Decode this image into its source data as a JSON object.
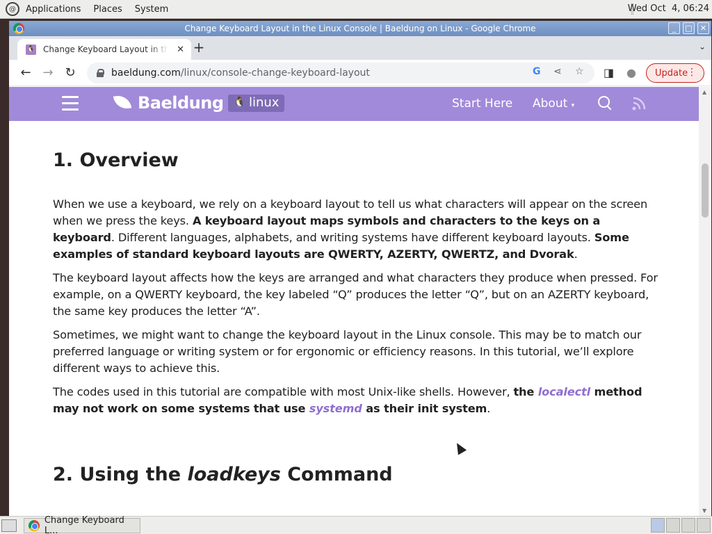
{
  "system_panel": {
    "menus": [
      "Applications",
      "Places",
      "System"
    ],
    "clock": "Wed Oct  4, 06:24"
  },
  "window": {
    "title": "Change Keyboard Layout in the Linux Console | Baeldung on Linux - Google Chrome",
    "buttons": [
      "_",
      "□",
      "✕"
    ]
  },
  "tabs": [
    {
      "title": "Change Keyboard Layout in the Linux Console | Baeldung on Linux",
      "close": "✕"
    }
  ],
  "new_tab": "+",
  "tab_list": "⌄",
  "toolbar": {
    "back": "←",
    "forward": "→",
    "reload": "↻",
    "url_host": "baeldung.com",
    "url_path": "/linux/console-change-keyboard-layout",
    "omnibox_icons": [
      "G",
      "⋖",
      "☆"
    ],
    "side_panel": "◨",
    "profile": "●",
    "update_label": "Update",
    "menu_dots": "⋮"
  },
  "site_nav": {
    "brand": "Baeldung",
    "badge": "linux",
    "links": [
      "Start Here",
      "About"
    ],
    "about_caret": "▾"
  },
  "article": {
    "h_overview": "1. Overview",
    "p1": [
      {
        "t": "When we use a keyboard, we rely on a keyboard layout to tell us what characters will appear on the screen when we press the keys. "
      },
      {
        "t": "A keyboard layout maps symbols and characters to the keys on a keyboard",
        "b": true
      },
      {
        "t": ". Different languages, alphabets, and writing systems have different keyboard layouts. "
      },
      {
        "t": "Some examples of standard keyboard layouts are QWERTY, AZERTY, QWERTZ, and Dvorak",
        "b": true
      },
      {
        "t": "."
      }
    ],
    "p2": "The keyboard layout affects how the keys are arranged and what characters they produce when pressed. For example, on a QWERTY keyboard, the key labeled “Q” produces the letter “Q”, but on an AZERTY keyboard, the same key produces the letter “A”.",
    "p3": "Sometimes, we might want to change the keyboard layout in the Linux console. This may be to match our preferred language or writing system or for ergonomic or efficiency reasons. In this tutorial, we’ll explore different ways to achieve this.",
    "p4": [
      {
        "t": "The codes used in this tutorial are compatible with most Unix-like shells. However, "
      },
      {
        "t": "the ",
        "b": true
      },
      {
        "t": "localectl",
        "code": true
      },
      {
        "t": " method may not work on some systems that use ",
        "b": true
      },
      {
        "t": "systemd",
        "code": true
      },
      {
        "t": " as their init system",
        "b": true
      },
      {
        "t": "."
      }
    ],
    "h_loadkeys_pre": "2. Using the ",
    "h_loadkeys_em": "loadkeys",
    "h_loadkeys_post": " Command"
  },
  "taskbar": {
    "task_label": "Change Keyboard L..."
  },
  "colors": {
    "site_nav_bg": "#a18ad9",
    "code_link": "#8f6fcf",
    "update_red": "#c5221f",
    "titlebar_blue": "#6d8fc1"
  }
}
